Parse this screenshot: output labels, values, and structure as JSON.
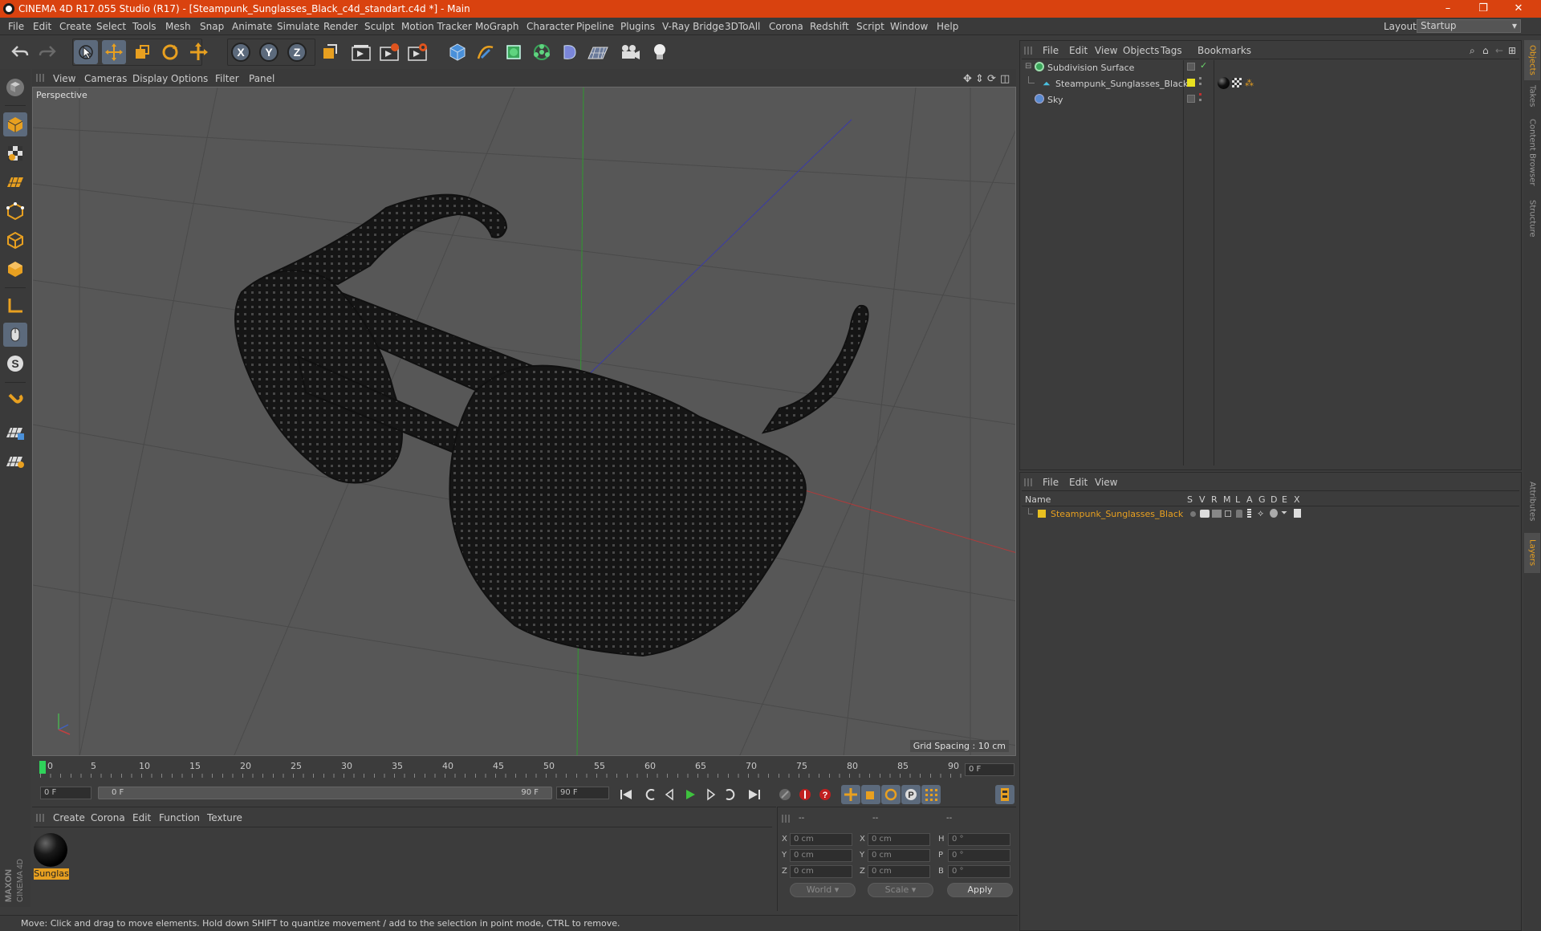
{
  "window": {
    "title": "CINEMA 4D R17.055 Studio (R17) - [Steampunk_Sunglasses_Black_c4d_standart.c4d *] - Main",
    "controls": [
      "–",
      "❐",
      "✕"
    ]
  },
  "menubar": {
    "items": [
      "File",
      "Edit",
      "Create",
      "Select",
      "Tools",
      "Mesh",
      "Snap",
      "Animate",
      "Simulate",
      "Render",
      "Sculpt",
      "Motion Tracker",
      "MoGraph",
      "Character",
      "Pipeline",
      "Plugins",
      "V-Ray Bridge",
      "3DToAll",
      "Corona",
      "Redshift",
      "Script",
      "Window",
      "Help"
    ],
    "layout_label": "Layout:",
    "layout_value": "Startup"
  },
  "viewport": {
    "menu": [
      "View",
      "Cameras",
      "Display",
      "Options",
      "Filter",
      "Panel"
    ],
    "label": "Perspective",
    "grid_spacing": "Grid Spacing : 10 cm"
  },
  "timeline": {
    "ticks": [
      "0",
      "5",
      "10",
      "15",
      "20",
      "25",
      "30",
      "35",
      "40",
      "45",
      "50",
      "55",
      "60",
      "65",
      "70",
      "75",
      "80",
      "85",
      "90"
    ],
    "current_frame_field": "0 F",
    "start_field": "0 F",
    "range_start": "0 F",
    "range_end": "90 F",
    "end_field": "90 F"
  },
  "material_panel": {
    "menu": [
      "Create",
      "Corona",
      "Edit",
      "Function",
      "Texture"
    ],
    "material_name": "Sunglas"
  },
  "coords": {
    "headers": [
      "--",
      "--",
      "--"
    ],
    "rows": [
      {
        "a": "X",
        "av": "0 cm",
        "b": "X",
        "bv": "0 cm",
        "c": "H",
        "cv": "0 °"
      },
      {
        "a": "Y",
        "av": "0 cm",
        "b": "Y",
        "bv": "0 cm",
        "c": "P",
        "cv": "0 °"
      },
      {
        "a": "Z",
        "av": "0 cm",
        "b": "Z",
        "bv": "0 cm",
        "c": "B",
        "cv": "0 °"
      }
    ],
    "world": "World",
    "scale": "Scale",
    "apply": "Apply"
  },
  "status": {
    "text": "Move: Click and drag to move elements. Hold down SHIFT to quantize movement / add to the selection in point mode, CTRL to remove."
  },
  "object_manager": {
    "menu": [
      "File",
      "Edit",
      "View",
      "Objects",
      "Tags",
      "Bookmarks"
    ],
    "objects": [
      {
        "name": "Subdivision Surface",
        "color": "#d0d0d0"
      },
      {
        "name": "Steampunk_Sunglasses_Black",
        "color": "#d0d0d0"
      },
      {
        "name": "Sky",
        "color": "#d0d0d0"
      }
    ]
  },
  "layer_manager": {
    "menu": [
      "File",
      "Edit",
      "View"
    ],
    "columns": [
      "Name",
      "S",
      "V",
      "R",
      "M",
      "L",
      "A",
      "G",
      "D",
      "E",
      "X"
    ],
    "layers": [
      {
        "name": "Steampunk_Sunglasses_Black",
        "color": "#e8a020"
      }
    ]
  },
  "right_tabs": [
    "Objects",
    "Takes",
    "Content Browser",
    "Structure",
    "Attributes",
    "Layers"
  ],
  "brand": "MAXON CINEMA 4D",
  "colors": {
    "accent": "#d9420f",
    "layer": "#e8c020",
    "selected_tool": "#5c6a7c"
  }
}
